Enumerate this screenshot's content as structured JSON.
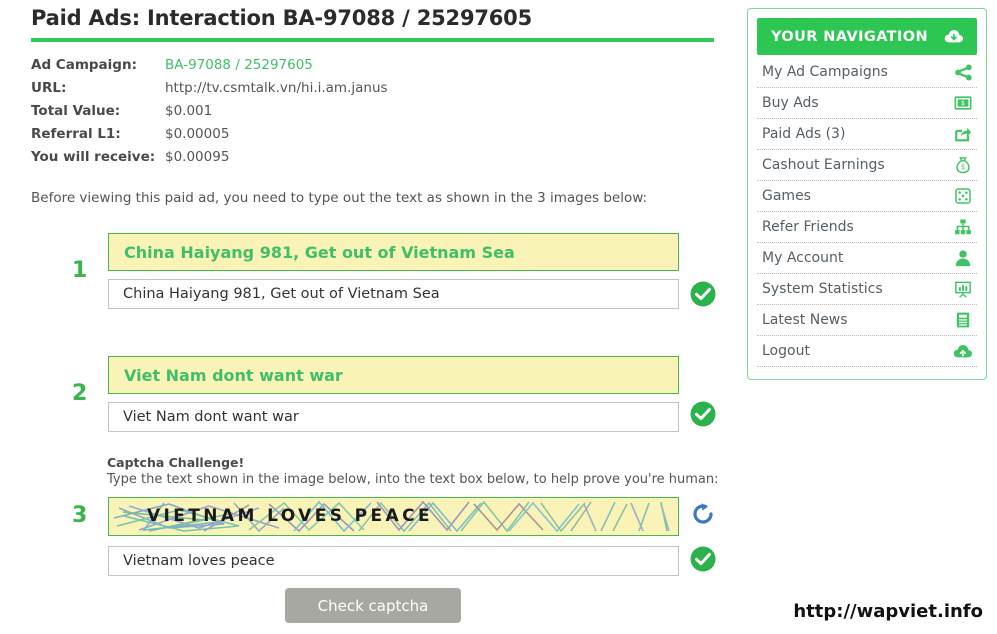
{
  "page": {
    "title": "Paid Ads: Interaction BA-97088 / 25297605",
    "accent_green": "#34c759",
    "watermark": "http://wapviet.info"
  },
  "info": {
    "rows": [
      {
        "label": "Ad Campaign:",
        "value": "BA-97088 / 25297605",
        "link_a": "BA-97088",
        "link_b": "25297605",
        "separator": "/"
      },
      {
        "label": "URL:",
        "value": "http://tv.csmtalk.vn/hi.i.am.janus"
      },
      {
        "label": "Total Value:",
        "value": "$0.001"
      },
      {
        "label": "Referral L1:",
        "value": "$0.00005"
      },
      {
        "label": "You will receive:",
        "value": "$0.00095"
      }
    ]
  },
  "instructions": "Before viewing this paid ad, you need to type out the text as shown in the 3 images below:",
  "challenges": [
    {
      "number": "1",
      "prompt": "China Haiyang 981, Get out of Vietnam Sea",
      "answer": "China Haiyang 981, Get out of Vietnam Sea",
      "status_icon": "check-circle-icon",
      "status_color": "#2bb24c"
    },
    {
      "number": "2",
      "prompt": "Viet Nam dont want war",
      "answer": "Viet Nam dont want war",
      "status_icon": "check-circle-icon",
      "status_color": "#2bb24c"
    }
  ],
  "captcha": {
    "number": "3",
    "heading": "Captcha Challenge!",
    "subheading": "Type the text shown in the image below, into the text box below, to help prove you're human:",
    "image_text": "VIETNAM LOVES PEACE",
    "answer": "Vietnam loves peace",
    "refresh_icon": "refresh-icon",
    "status_icon": "check-circle-icon",
    "status_color": "#2bb24c",
    "background_color": "#faf3b8",
    "border_color": "#49b74b"
  },
  "submit": {
    "label": "Check captcha",
    "color": "#a8a8a2"
  },
  "nav": {
    "header": {
      "title": "YOUR NAVIGATION",
      "icon": "cloud-download-icon",
      "background": "#2dc653"
    },
    "items": [
      {
        "label": "My Ad Campaigns",
        "icon": "share-nodes-icon"
      },
      {
        "label": "Buy Ads",
        "icon": "money-bill-icon"
      },
      {
        "label": "Paid Ads (3)",
        "icon": "share-square-icon"
      },
      {
        "label": "Cashout Earnings",
        "icon": "money-bag-icon"
      },
      {
        "label": "Games",
        "icon": "dice-icon"
      },
      {
        "label": "Refer Friends",
        "icon": "sitemap-icon"
      },
      {
        "label": "My Account",
        "icon": "user-icon"
      },
      {
        "label": "System Statistics",
        "icon": "chart-presentation-icon"
      },
      {
        "label": "Latest News",
        "icon": "news-document-icon"
      },
      {
        "label": "Logout",
        "icon": "cloud-upload-icon"
      }
    ]
  }
}
